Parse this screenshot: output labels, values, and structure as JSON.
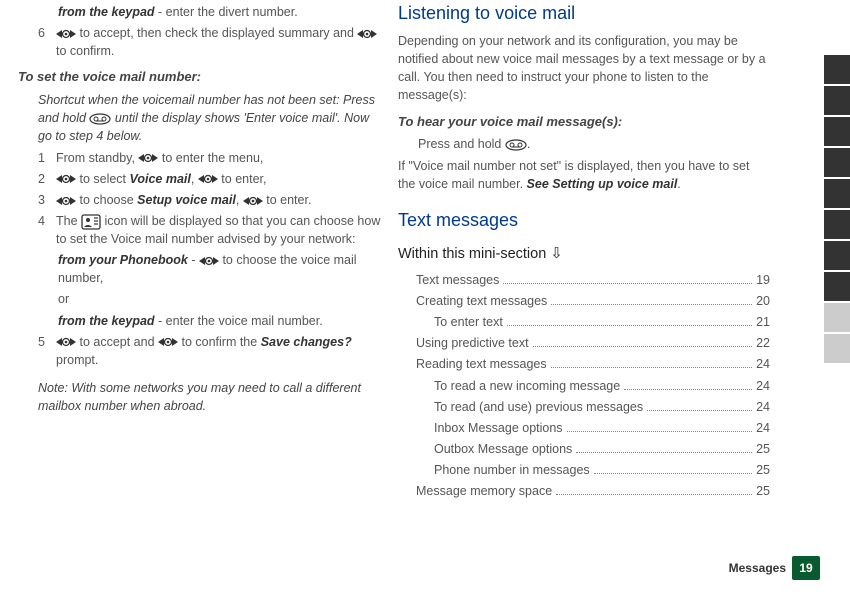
{
  "left": {
    "keypad_line_prefix": "from the keypad",
    "keypad_line_rest": " - enter the divert number.",
    "step6_num": "6",
    "step6_txt_a": " to accept, then check the displayed summary and ",
    "step6_txt_b": " to confirm.",
    "set_vm_head": "To set the voice mail number:",
    "shortcut_a": "Shortcut when the voicemail number has not been set: Press and hold ",
    "shortcut_b": " until the display shows 'Enter voice mail'. Now go to step 4 below.",
    "s1_num": "1",
    "s1_a": "From standby, ",
    "s1_b": " to enter the menu,",
    "s2_num": "2",
    "s2_a": " to select ",
    "s2_vm": "Voice mail",
    "s2_b": ", ",
    "s2_c": " to enter,",
    "s3_num": "3",
    "s3_a": " to choose ",
    "s3_setup": "Setup voice mail",
    "s3_b": ", ",
    "s3_c": " to enter.",
    "s4_num": "4",
    "s4_a": "The ",
    "s4_b": " icon will be displayed so that you can choose how to set the Voice mail number advised by your network:",
    "s4_pb_a": "from your Phonebook",
    "s4_pb_b": " - ",
    "s4_pb_c": " to choose the voice mail number,",
    "s4_or": "or",
    "s4_kp_a": "from the keypad",
    "s4_kp_b": " - enter the voice mail number.",
    "s5_num": "5",
    "s5_a": " to accept and ",
    "s5_b": " to confirm the ",
    "s5_save": "Save changes?",
    "s5_c": " prompt.",
    "note": "Note: With some networks you may need to call a different mailbox number when abroad."
  },
  "right": {
    "head1": "Listening to voice mail",
    "p1": "Depending on your network and its configuration, you may be notified about new voice mail messages by a text message or by a call. You then need to instruct your phone to listen to the message(s):",
    "hear_head": "To hear your voice mail message(s):",
    "hear_a": "Press and hold ",
    "hear_b": ".",
    "p2_a": "If \"Voice mail number not set\" is displayed, then you have to set the voice mail number. ",
    "p2_b": "See Setting up voice mail",
    "p2_c": ".",
    "head2": "Text messages",
    "mini": "Within this mini-section",
    "toc": [
      {
        "label": "Text messages",
        "page": "19",
        "sub": false
      },
      {
        "label": "Creating text messages",
        "page": "20",
        "sub": false
      },
      {
        "label": "To enter text",
        "page": "21",
        "sub": true
      },
      {
        "label": "Using predictive text",
        "page": "22",
        "sub": false
      },
      {
        "label": "Reading text messages",
        "page": "24",
        "sub": false
      },
      {
        "label": "To read a new incoming message",
        "page": "24",
        "sub": true
      },
      {
        "label": "To read (and use) previous messages",
        "page": "24",
        "sub": true
      },
      {
        "label": "Inbox Message options",
        "page": "24",
        "sub": true
      },
      {
        "label": "Outbox Message options",
        "page": "25",
        "sub": true
      },
      {
        "label": "Phone number in messages",
        "page": "25",
        "sub": true
      },
      {
        "label": "Message memory space",
        "page": "25",
        "sub": false
      }
    ]
  },
  "footer": {
    "label": "Messages",
    "page": "19"
  }
}
